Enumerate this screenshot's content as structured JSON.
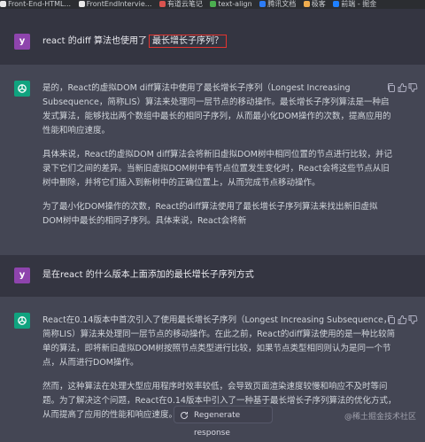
{
  "bookmarks": [
    {
      "label": "Front-End-HTML...",
      "icon": "github-icon",
      "color": "#e8e8e8"
    },
    {
      "label": "FrontEndIntervie...",
      "icon": "github-icon",
      "color": "#e8e8e8"
    },
    {
      "label": "有道云笔记",
      "icon": "youdao-icon",
      "color": "#d9534f"
    },
    {
      "label": "text-align",
      "icon": "w3-icon",
      "color": "#4caf50"
    },
    {
      "label": "腾讯文档",
      "icon": "tencent-docs-icon",
      "color": "#2d7cf6"
    },
    {
      "label": "极客",
      "icon": "geek-icon",
      "color": "#f0ad4e"
    },
    {
      "label": "前端 - 掘金",
      "icon": "juejin-icon",
      "color": "#1e80ff"
    }
  ],
  "messages": [
    {
      "role": "user",
      "avatar": "y",
      "prefix": "react 的diff 算法也使用了",
      "highlight": "最长增长子序列？"
    },
    {
      "role": "assistant",
      "paragraphs": [
        "是的，React的虚拟DOM diff算法中使用了最长增长子序列（Longest Increasing Subsequence，简称LIS）算法来处理同一层节点的移动操作。最长增长子序列算法是一种启发式算法，能够找出两个数组中最长的相同子序列，从而最小化DOM操作的次数，提高应用的性能和响应速度。",
        "具体来说，React的虚拟DOM diff算法会将新旧虚拟DOM树中相同位置的节点进行比较，并记录下它们之间的差异。当新旧虚拟DOM树中有节点位置发生变化时，React会将这些节点从旧树中删除，并将它们插入到新树中的正确位置上，从而完成节点移动操作。",
        "为了最小化DOM操作的次数，React的diff算法使用了最长增长子序列算法来找出新旧虚拟DOM树中最长的相同子序列。具体来说，React会将新"
      ]
    },
    {
      "role": "user",
      "avatar": "y",
      "prefix": "是在react 的什么版本上面添加的最长增长子序列方式",
      "highlight": ""
    },
    {
      "role": "assistant",
      "paragraphs": [
        "React在0.14版本中首次引入了使用最长增长子序列（Longest Increasing Subsequence，简称LIS）算法来处理同一层节点的移动操作。在此之前，React的diff算法使用的是一种比较简单的算法，即将新旧虚拟DOM树按照节点类型进行比较，如果节点类型相同则认为是同一个节点，从而进行DOM操作。",
        "然而，这种算法在处理大型应用程序时效率较低，会导致页面渲染速度较慢和响应不及时等问题。为了解决这个问题，React在0.14版本中引入了一种基于最长增长子序列算法的优化方式，从而提高了应用的性能和响应速度。"
      ]
    }
  ],
  "regenerate_label": "Regenerate response",
  "watermark": "@稀土掘金技术社区",
  "colors": {
    "user_bg": "#343541",
    "assistant_bg": "#444654",
    "highlight_border": "#e3342f",
    "gpt_avatar": "#10a37f",
    "user_avatar": "#8e44ad"
  }
}
